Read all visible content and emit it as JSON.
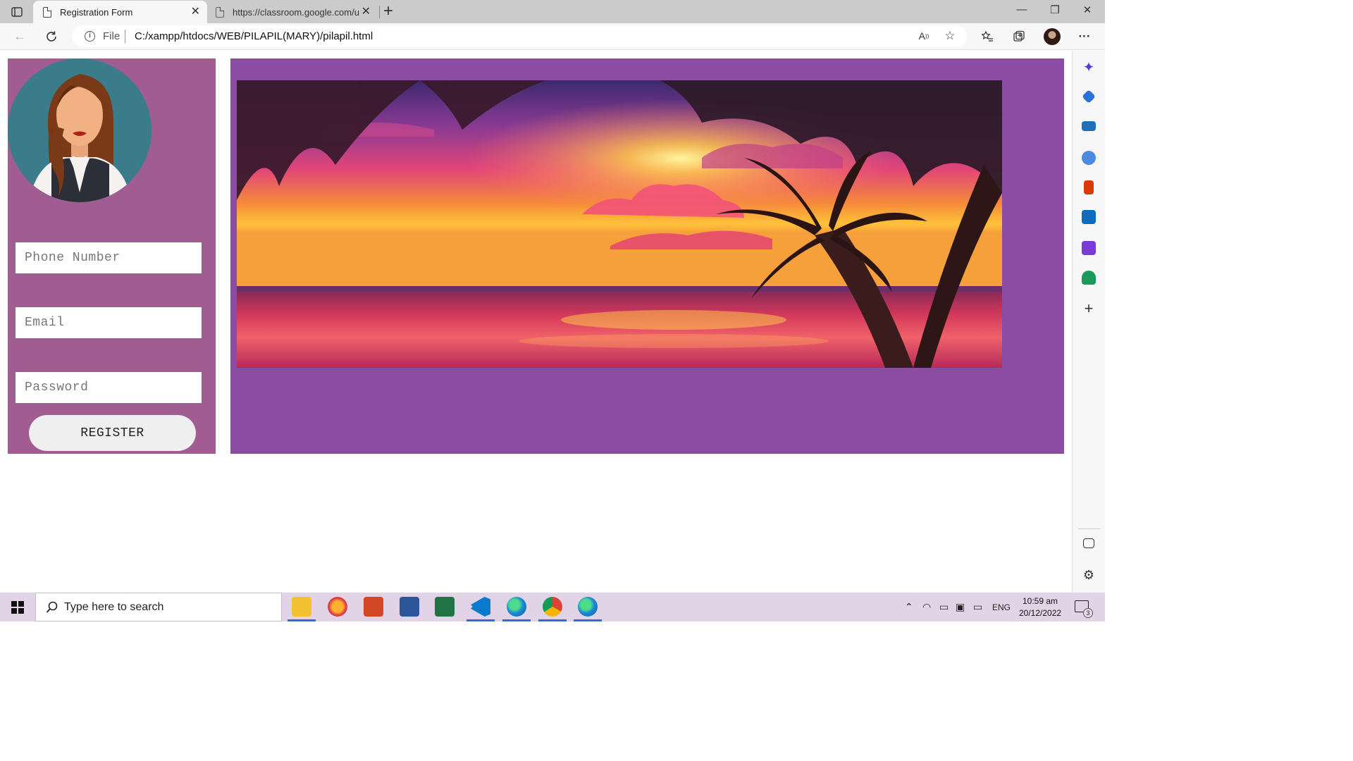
{
  "browser": {
    "tabs": [
      {
        "label": "Registration Form",
        "active": true
      },
      {
        "label": "https://classroom.google.com/u/",
        "active": false
      }
    ],
    "address_bar": {
      "scheme_label": "File",
      "url": "C:/xampp/htdocs/WEB/PILAPIL(MARY)/pilapil.html"
    }
  },
  "page": {
    "form": {
      "phone_placeholder": "Phone Number",
      "email_placeholder": "Email",
      "password_placeholder": "Password",
      "register_label": "REGISTER"
    },
    "colors": {
      "left_panel": "#a15c92",
      "right_panel": "#8b4ca6"
    }
  },
  "taskbar": {
    "search_placeholder": "Type here to search",
    "language": "ENG",
    "time": "10:59 am",
    "date": "20/12/2022",
    "notification_count": "3",
    "apps": [
      "file-explorer",
      "firefox",
      "powerpoint",
      "word",
      "excel",
      "vscode",
      "edge",
      "chrome",
      "edge"
    ]
  }
}
